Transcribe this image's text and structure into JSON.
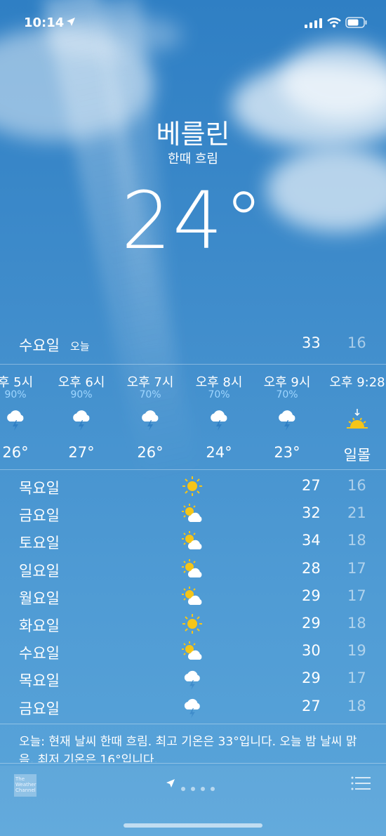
{
  "status": {
    "time": "10:14"
  },
  "location": {
    "city": "베를린",
    "condition": "한때 흐림",
    "temperature": "24°"
  },
  "today": {
    "day": "수요일",
    "label": "오늘",
    "high": "33",
    "low": "16"
  },
  "hourly": [
    {
      "time": "후 5시",
      "precip": "90%",
      "icon": "thunderstorm-icon",
      "temp": "26°"
    },
    {
      "time": "오후 6시",
      "precip": "90%",
      "icon": "thunderstorm-icon",
      "temp": "27°"
    },
    {
      "time": "오후 7시",
      "precip": "70%",
      "icon": "thunderstorm-icon",
      "temp": "26°"
    },
    {
      "time": "오후 8시",
      "precip": "70%",
      "icon": "thunderstorm-icon",
      "temp": "24°"
    },
    {
      "time": "오후 9시",
      "precip": "70%",
      "icon": "thunderstorm-icon",
      "temp": "23°"
    },
    {
      "time": "오후 9:28",
      "precip": "",
      "icon": "sunset-icon",
      "temp": "일몰"
    }
  ],
  "daily": [
    {
      "day": "목요일",
      "icon": "sun-icon",
      "high": "27",
      "low": "16"
    },
    {
      "day": "금요일",
      "icon": "partly-cloudy-icon",
      "high": "32",
      "low": "21"
    },
    {
      "day": "토요일",
      "icon": "partly-cloudy-icon",
      "high": "34",
      "low": "18"
    },
    {
      "day": "일요일",
      "icon": "partly-cloudy-icon",
      "high": "28",
      "low": "17"
    },
    {
      "day": "월요일",
      "icon": "partly-cloudy-icon",
      "high": "29",
      "low": "17"
    },
    {
      "day": "화요일",
      "icon": "sun-icon",
      "high": "29",
      "low": "18"
    },
    {
      "day": "수요일",
      "icon": "partly-cloudy-icon",
      "high": "30",
      "low": "19"
    },
    {
      "day": "목요일",
      "icon": "thunderstorm-icon",
      "high": "29",
      "low": "17"
    },
    {
      "day": "금요일",
      "icon": "thunderstorm-icon",
      "high": "27",
      "low": "18"
    }
  ],
  "summary": "오늘: 현재 날씨 한때 흐림. 최고 기온은 33°입니다. 오늘 밤 날씨 맑음, 최저 기온은 16°입니다.",
  "footer": {
    "provider_logo": "The Weather Channel",
    "page_count": 4
  },
  "colors": {
    "sky_top": "#2f7fc4",
    "sky_bottom": "#5aa5da",
    "precip_text": "#9fd6ff",
    "sun_yellow": "#f5c518"
  }
}
